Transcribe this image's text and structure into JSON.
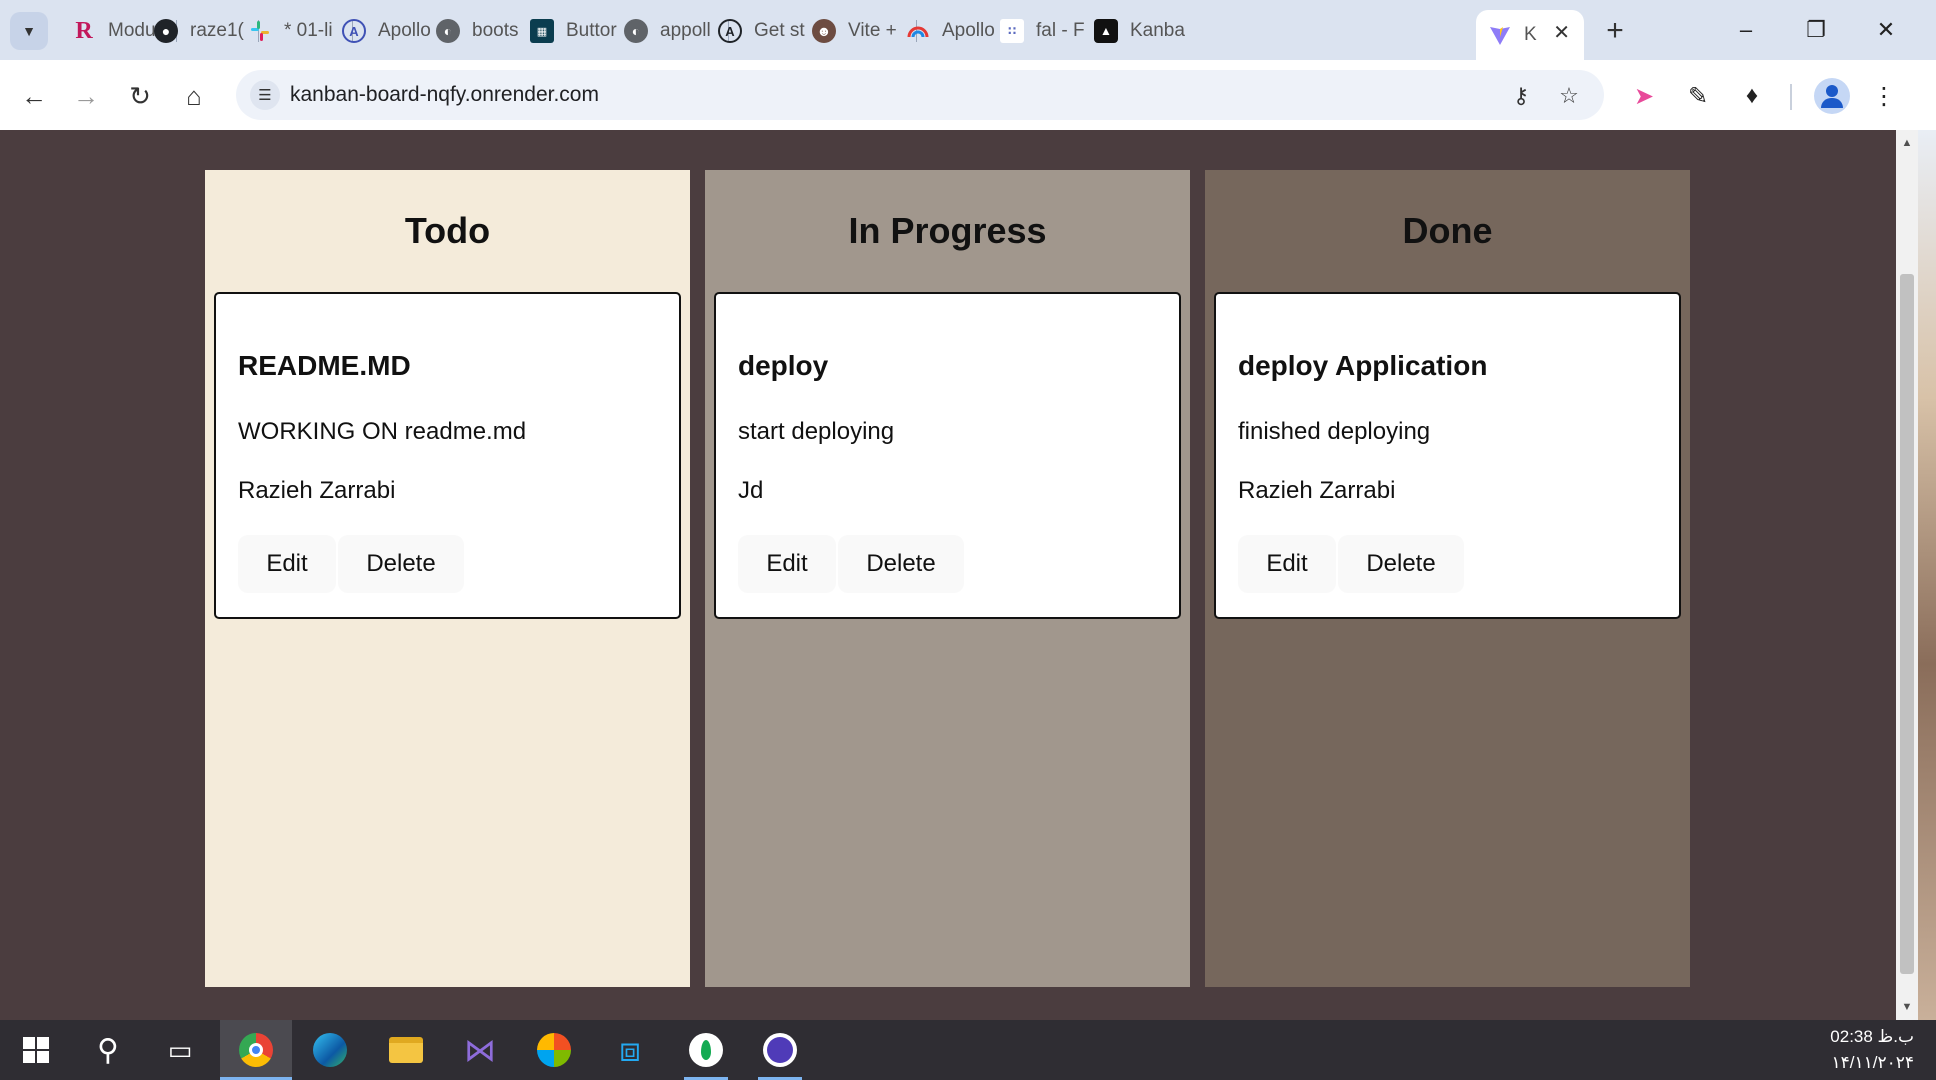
{
  "browser": {
    "tabs": [
      {
        "label": "Modu",
        "icon": "r-logo-icon",
        "color": "#c2185b"
      },
      {
        "label": "raze1(",
        "icon": "github-icon",
        "color": "#1f2328"
      },
      {
        "label": "* 01-li",
        "icon": "slack-icon",
        "color": "#e01e5a"
      },
      {
        "label": "Apollo",
        "icon": "apollo-icon",
        "color": "#3f51b5"
      },
      {
        "label": "boots",
        "icon": "globe-icon",
        "color": "#5f6368"
      },
      {
        "label": "Buttor",
        "icon": "grid-logo-icon",
        "color": "#0b3d4f"
      },
      {
        "label": "appoll",
        "icon": "globe-icon",
        "color": "#5f6368"
      },
      {
        "label": "Get st",
        "icon": "apollo-icon",
        "color": "#1f2328"
      },
      {
        "label": "Vite +",
        "icon": "avatar-icon",
        "color": "#6d4c41"
      },
      {
        "label": "Apollo",
        "icon": "rainbow-icon",
        "color": "#e53935"
      },
      {
        "label": "fal - F",
        "icon": "dots-icon",
        "color": "#5c6bc0"
      },
      {
        "label": "Kanba",
        "icon": "render-icon",
        "color": "#111111"
      }
    ],
    "active_tab": {
      "label": "K",
      "icon": "vite-icon"
    },
    "address": "kanban-board-nqfy.onrender.com"
  },
  "board": {
    "columns": [
      {
        "title": "Todo",
        "card": {
          "title": "README.MD",
          "description": "WORKING ON readme.md",
          "assignee": "Razieh Zarrabi",
          "edit": "Edit",
          "delete": "Delete"
        }
      },
      {
        "title": "In Progress",
        "card": {
          "title": "deploy",
          "description": "start deploying",
          "assignee": "Jd",
          "edit": "Edit",
          "delete": "Delete"
        }
      },
      {
        "title": "Done",
        "card": {
          "title": "deploy Application",
          "description": "finished deploying",
          "assignee": "Razieh Zarrabi",
          "edit": "Edit",
          "delete": "Delete"
        }
      }
    ],
    "colors": {
      "todo": "#f4ebda",
      "in_progress": "#a1978d",
      "done": "#76675c",
      "page_bg": "#4b3d3f"
    }
  },
  "taskbar": {
    "apps": [
      "start-icon",
      "search-icon",
      "task-view-icon",
      "chrome-icon",
      "edge-icon",
      "file-explorer-icon",
      "visual-studio-icon",
      "app-icon",
      "vscode-icon",
      "mongodb-icon",
      "app-icon"
    ],
    "clock_time": "02:38 ب.ظ",
    "clock_date": "۱۴/۱۱/۲۰۲۴"
  }
}
